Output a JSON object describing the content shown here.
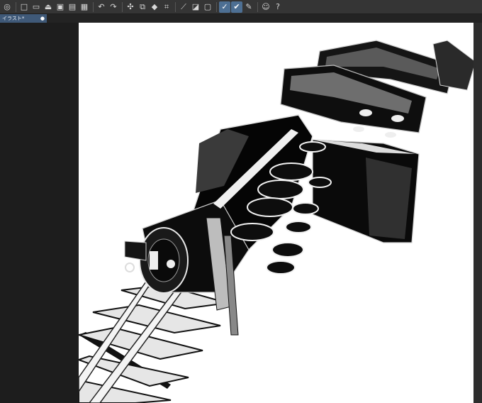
{
  "document": {
    "tab_title": "イラスト*",
    "tab_close_glyph": "●"
  },
  "toolbar": {
    "icons": [
      "app-icon",
      "new-icon",
      "open-icon",
      "export-icon",
      "save-icon",
      "save-as-icon",
      "undo-icon",
      "redo-icon",
      "transform-icon",
      "copy-icon",
      "fill-icon",
      "crop-icon",
      "ruler-icon",
      "layer-icon",
      "frame-icon",
      "brush-icon",
      "check-icon",
      "pen-icon",
      "user-icon",
      "help-icon"
    ]
  },
  "colors": {
    "accent": "#4d6f93",
    "tab_active": "#3f5978",
    "canvas": "#ffffff",
    "background": "#2b2b2b"
  }
}
